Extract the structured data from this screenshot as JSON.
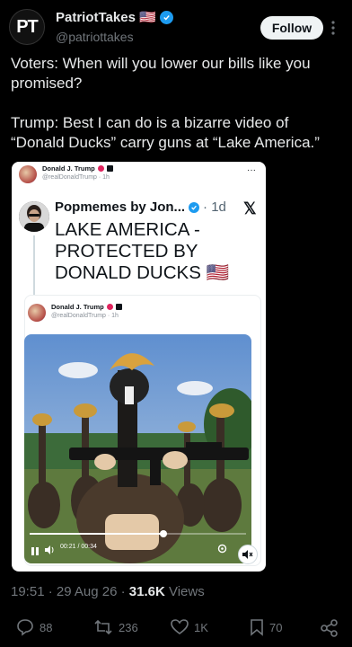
{
  "header": {
    "avatar_text": "PT",
    "display_name": "PatriotTakes 🇺🇸",
    "handle": "@patriottakes",
    "follow_label": "Follow"
  },
  "tweet": {
    "line1": "Voters: When will you lower our bills like you promised?",
    "line2": "Trump: Best I can do is a bizarre video of “Donald Ducks” carry guns at “Lake America.”"
  },
  "embed": {
    "author_name": "Donald J. Trump",
    "author_handle": "@realDonaldTrump · 1h",
    "more_label": "···",
    "quoted": {
      "name": "Popmemes by Jon...",
      "time": "· 1d",
      "x_label": "𝕏",
      "text": "LAKE AMERICA - PROTECTED BY DONALD DUCKS 🇺🇸"
    },
    "inner": {
      "author_name": "Donald J. Trump",
      "author_handle": "@realDonaldTrump · 1h"
    },
    "video": {
      "time": "00:21 / 00:34",
      "progress": 0.62
    }
  },
  "meta": {
    "time": "19:51 · 29 Aug 26 · ",
    "views_count": "31.6K",
    "views_label": " Views"
  },
  "actions": {
    "replies": "88",
    "reposts": "236",
    "likes": "1K",
    "bookmarks": "70"
  }
}
